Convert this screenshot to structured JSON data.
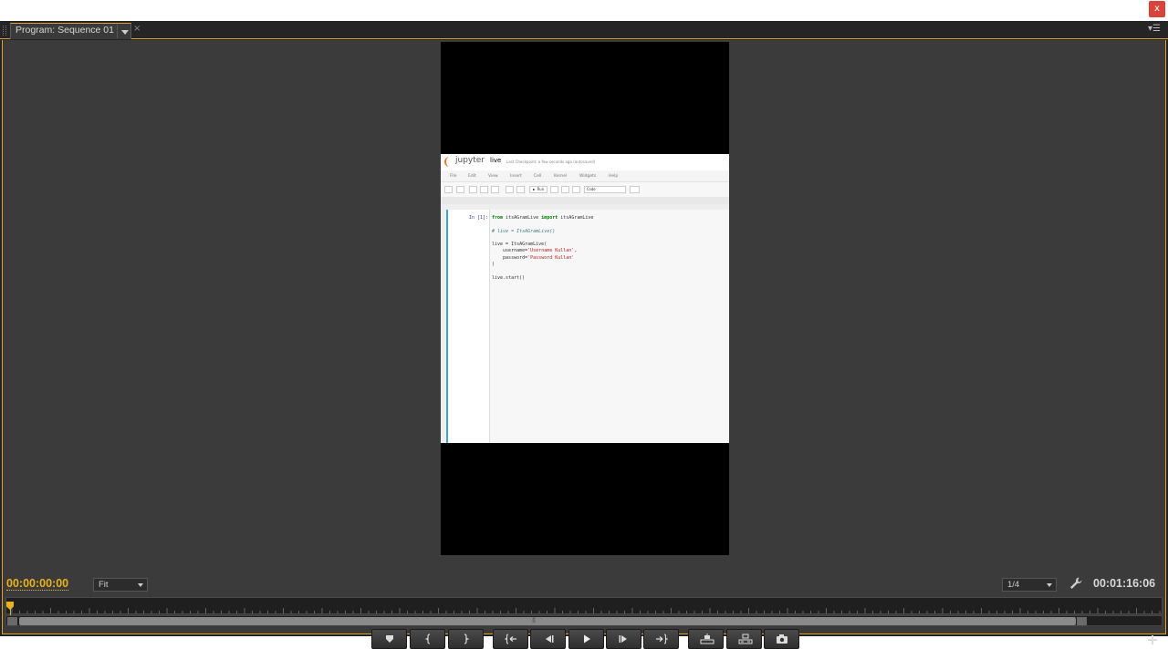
{
  "window": {
    "close_glyph": "x"
  },
  "panel": {
    "tab_label": "Program: Sequence 01",
    "tab_close_glyph": "×",
    "panel_menu_glyph": "▾☰"
  },
  "jupyter": {
    "brand": "jupyter",
    "notebook_name": "live",
    "checkpoint_text": "Last Checkpoint: a few seconds ago  (autosaved)",
    "menu": [
      "File",
      "Edit",
      "View",
      "Insert",
      "Cell",
      "Kernel",
      "Widgets",
      "Help"
    ],
    "toolbar": {
      "run_label": "▶ Run",
      "cell_type": "Code"
    },
    "cell_prompt": "In [1]:",
    "code": {
      "line1_kw1": "from",
      "line1_mod": " itsAGramLive ",
      "line1_kw2": "import",
      "line1_name": " itsAGramLive",
      "line2": "# live = ItsAGramLive()",
      "line3": "live = ItsAGramLive(",
      "line4_pre": "    username=",
      "line4_str": "'Username Kullan'",
      "line4_post": ",",
      "line5_pre": "    password=",
      "line5_str": "'Password Kullan'",
      "line6": ")",
      "line7": "live.start()"
    }
  },
  "monitor": {
    "current_timecode": "00:00:00:00",
    "zoom_label": "Fit",
    "resolution_label": "1/4",
    "duration_timecode": "00:01:16:06"
  },
  "transport": [
    {
      "name": "add-marker-button",
      "icon": "marker-icon"
    },
    {
      "name": "mark-in-button",
      "icon": "mark-in-icon"
    },
    {
      "name": "mark-out-button",
      "icon": "mark-out-icon"
    },
    {
      "name": "go-to-in-button",
      "icon": "go-to-in-icon"
    },
    {
      "name": "step-back-button",
      "icon": "step-back-icon"
    },
    {
      "name": "play-button",
      "icon": "play-icon"
    },
    {
      "name": "step-forward-button",
      "icon": "step-forward-icon"
    },
    {
      "name": "go-to-out-button",
      "icon": "go-to-out-icon"
    },
    {
      "name": "lift-button",
      "icon": "lift-icon"
    },
    {
      "name": "extract-button",
      "icon": "extract-icon"
    },
    {
      "name": "export-frame-button",
      "icon": "camera-icon"
    }
  ],
  "colors": {
    "accent": "#e09f2f",
    "timecode": "#e8b21a",
    "panel_bg": "#3b3b3b",
    "close": "#d9443a"
  }
}
